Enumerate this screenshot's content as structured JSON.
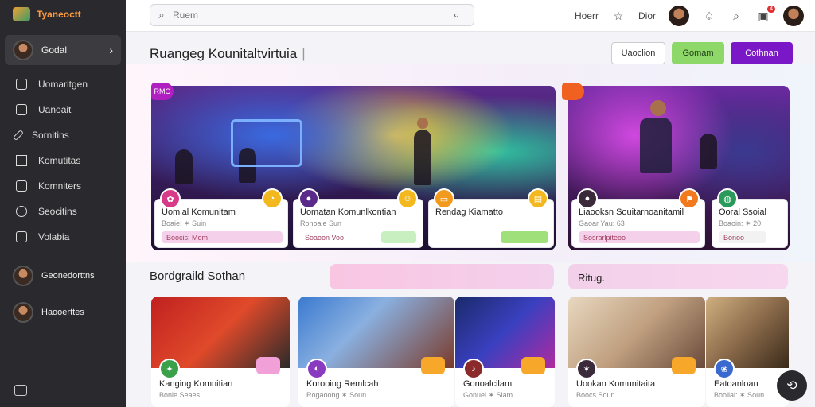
{
  "app": {
    "name": "Tyaneoctt"
  },
  "sidebar": {
    "user": {
      "name": "Godal"
    },
    "items": [
      {
        "label": "Uomaritgen",
        "icon": "home-icon"
      },
      {
        "label": "Uanoait",
        "icon": "document-icon"
      },
      {
        "label": "Sornitins",
        "icon": "pen-icon"
      },
      {
        "label": "Komutitas",
        "icon": "grid-icon"
      },
      {
        "label": "Komniters",
        "icon": "people-icon"
      },
      {
        "label": "Seocitins",
        "icon": "clock-icon"
      },
      {
        "label": "Volabia",
        "icon": "info-icon"
      }
    ],
    "people": [
      {
        "name": "Geonedorttns"
      },
      {
        "name": "Haooerttes"
      }
    ]
  },
  "topbar": {
    "search_placeholder": "Ruem",
    "links": [
      "Hoerr",
      "Dior"
    ],
    "notification_count": "4"
  },
  "page": {
    "title": "Ruangeg Kounitaltvirtuia",
    "buttons": {
      "outline": "Uaoclion",
      "green": "Gomam",
      "purple": "Cothnan"
    }
  },
  "featured": {
    "tags": [
      "RMO",
      ""
    ],
    "items": [
      {
        "title": "Uomial Komunitam",
        "sub": "Boaie: ✶ Suin",
        "pill": "Boocis: Mom",
        "pill_color": "#f5d0ea"
      },
      {
        "title": "Uomatan Komunlkontian",
        "sub": "Ronoaie Sun",
        "pill": "Soaoon Voo",
        "pill_color": "#c8efc0"
      },
      {
        "title": "Rendag Kiamatto",
        "sub": "",
        "pill": "",
        "pill_color": "#9fe07a"
      },
      {
        "title": "Liaooksn Souitarnoanitamil",
        "sub": "Gaoar Yau: 63",
        "pill": "Sosrarlpiteoo",
        "pill_color": "#f5d0ea"
      },
      {
        "title": "Ooral Ssoial",
        "sub": "Boaoin: ✶ 20",
        "pill": "Bonoo",
        "pill_color": "#f2f2f2"
      }
    ]
  },
  "sections": [
    {
      "title": "Bordgraild Sothan"
    },
    {
      "title": "Ritug."
    }
  ],
  "cards": [
    {
      "title": "Kanging Komnitian",
      "sub": "Bonie Seaes"
    },
    {
      "title": "Korooing Remlcah",
      "sub": "Rogaoong ✶ Soun"
    },
    {
      "title": "Gonoalcilam",
      "sub": "Gonuei ✶ Siam"
    },
    {
      "title": "Uookan Komunitaita",
      "sub": "Boocs Soun"
    },
    {
      "title": "Eatoanloan",
      "sub": "Booliai: ✶ Soun"
    }
  ]
}
